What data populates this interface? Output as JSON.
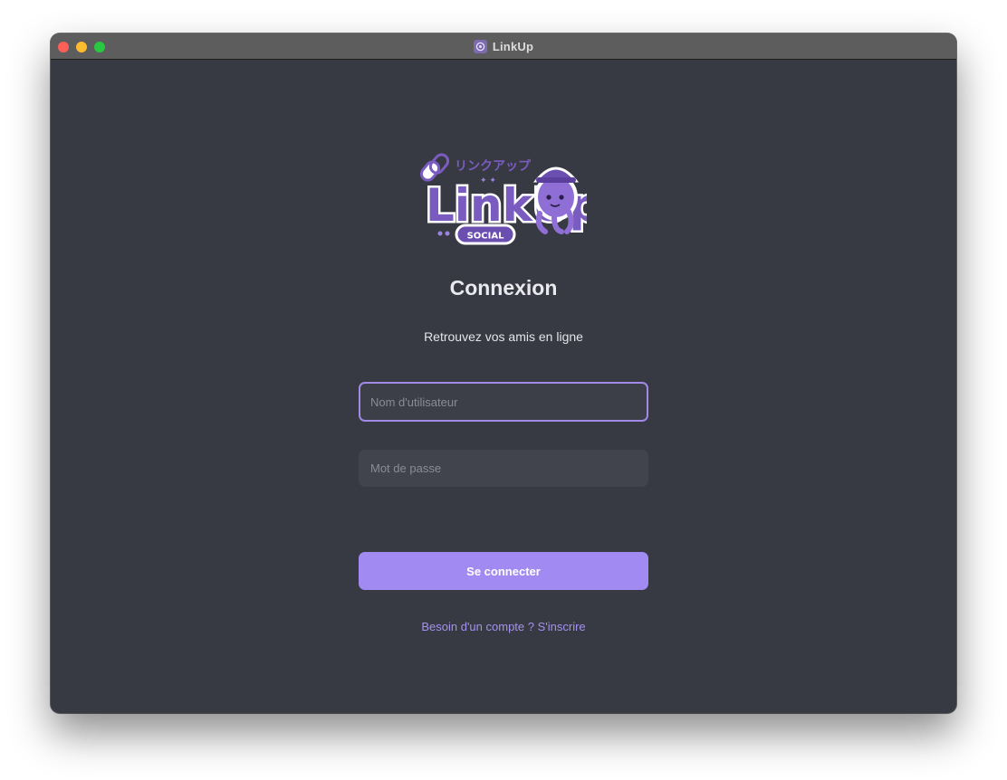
{
  "window": {
    "title": "LinkUp",
    "app_icon": "linkup-app-icon"
  },
  "logo": {
    "wordmark": "LinkUp",
    "katakana": "リンクアップ",
    "badge": "SOCIAL",
    "mascot": "octopus-detective-mascot"
  },
  "login": {
    "heading": "Connexion",
    "subheading": "Retrouvez vos amis en ligne",
    "username_placeholder": "Nom d'utilisateur",
    "username_value": "",
    "password_placeholder": "Mot de passe",
    "password_value": "",
    "submit_label": "Se connecter",
    "signup_link": "Besoin d'un compte ? S'inscrire"
  },
  "colors": {
    "background": "#383a43",
    "accent": "#a18af1",
    "link": "#a591ef",
    "field_bg": "#42444d",
    "focus_border": "#a08ae6"
  }
}
